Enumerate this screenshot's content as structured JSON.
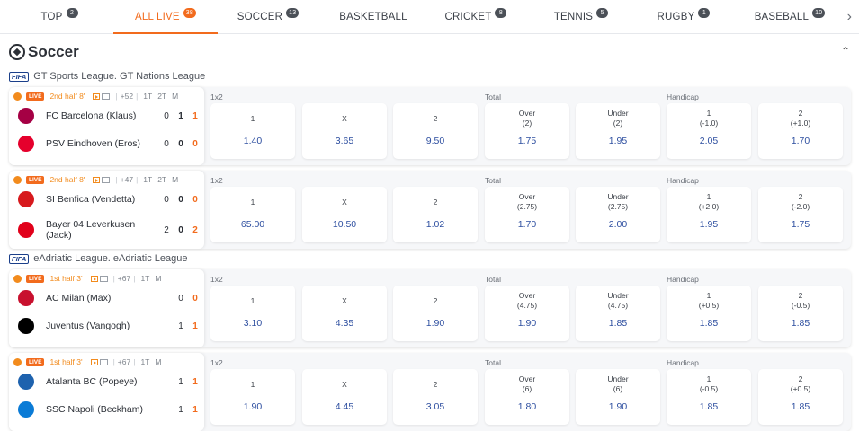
{
  "tabs": [
    {
      "label": "TOP",
      "count": "2"
    },
    {
      "label": "ALL LIVE",
      "count": "38",
      "active": true
    },
    {
      "label": "SOCCER",
      "count": "13"
    },
    {
      "label": "BASKETBALL",
      "count": ""
    },
    {
      "label": "CRICKET",
      "count": "8"
    },
    {
      "label": "TENNIS",
      "count": "5"
    },
    {
      "label": "RUGBY",
      "count": "1"
    },
    {
      "label": "BASEBALL",
      "count": "10"
    }
  ],
  "section": {
    "title": "Soccer"
  },
  "leagues": [
    {
      "badge": "FIFA",
      "name": "GT Sports League. GT Nations League"
    },
    {
      "badge": "FIFA",
      "name": "eAdriatic League. eAdriatic League"
    }
  ],
  "market_labels": {
    "m1x2": "1x2",
    "total": "Total",
    "handicap": "Handicap"
  },
  "score_headers": {
    "h1": "1T",
    "h2": "2T",
    "h3": "M"
  },
  "matches": [
    {
      "live": "LIVE",
      "period": "2nd half 8'",
      "more": "+52",
      "home": {
        "name": "FC Barcelona (Klaus)",
        "s1": "0",
        "s2": "1",
        "s3": "1"
      },
      "away": {
        "name": "PSV Eindhoven (Eros)",
        "s1": "0",
        "s2": "0",
        "s3": "0"
      },
      "odds": [
        {
          "label": "1",
          "value": "1.40"
        },
        {
          "label": "X",
          "value": "3.65"
        },
        {
          "label": "2",
          "value": "9.50"
        },
        {
          "label": "Over",
          "sub": "(2)",
          "value": "1.75"
        },
        {
          "label": "Under",
          "sub": "(2)",
          "value": "1.95"
        },
        {
          "label": "1",
          "sub": "(-1.0)",
          "value": "2.05"
        },
        {
          "label": "2",
          "sub": "(+1.0)",
          "value": "1.70"
        }
      ]
    },
    {
      "live": "LIVE",
      "period": "2nd half 8'",
      "more": "+47",
      "home": {
        "name": "SI Benfica (Vendetta)",
        "s1": "0",
        "s2": "0",
        "s3": "0"
      },
      "away": {
        "name": "Bayer 04 Leverkusen (Jack)",
        "s1": "2",
        "s2": "0",
        "s3": "2"
      },
      "odds": [
        {
          "label": "1",
          "value": "65.00"
        },
        {
          "label": "X",
          "value": "10.50"
        },
        {
          "label": "2",
          "value": "1.02"
        },
        {
          "label": "Over",
          "sub": "(2.75)",
          "value": "1.70"
        },
        {
          "label": "Under",
          "sub": "(2.75)",
          "value": "2.00"
        },
        {
          "label": "1",
          "sub": "(+2.0)",
          "value": "1.95"
        },
        {
          "label": "2",
          "sub": "(-2.0)",
          "value": "1.75"
        }
      ]
    },
    {
      "live": "LIVE",
      "period": "1st half 3'",
      "more": "+67",
      "home": {
        "name": "AC Milan (Max)",
        "s1": "0",
        "s3": "0"
      },
      "away": {
        "name": "Juventus (Vangogh)",
        "s1": "1",
        "s3": "1"
      },
      "odds": [
        {
          "label": "1",
          "value": "3.10"
        },
        {
          "label": "X",
          "value": "4.35"
        },
        {
          "label": "2",
          "value": "1.90"
        },
        {
          "label": "Over",
          "sub": "(4.75)",
          "value": "1.90"
        },
        {
          "label": "Under",
          "sub": "(4.75)",
          "value": "1.85"
        },
        {
          "label": "1",
          "sub": "(+0.5)",
          "value": "1.85"
        },
        {
          "label": "2",
          "sub": "(-0.5)",
          "value": "1.85"
        }
      ]
    },
    {
      "live": "LIVE",
      "period": "1st half 3'",
      "more": "+67",
      "home": {
        "name": "Atalanta BC (Popeye)",
        "s1": "1",
        "s3": "1"
      },
      "away": {
        "name": "SSC Napoli (Beckham)",
        "s1": "1",
        "s3": "1"
      },
      "odds": [
        {
          "label": "1",
          "value": "1.90"
        },
        {
          "label": "X",
          "value": "4.45"
        },
        {
          "label": "2",
          "value": "3.05"
        },
        {
          "label": "Over",
          "sub": "(6)",
          "value": "1.80"
        },
        {
          "label": "Under",
          "sub": "(6)",
          "value": "1.90"
        },
        {
          "label": "1",
          "sub": "(-0.5)",
          "value": "1.85"
        },
        {
          "label": "2",
          "sub": "(+0.5)",
          "value": "1.85"
        }
      ]
    }
  ],
  "colors": {
    "accent": "#f26b1d",
    "odd_value": "#2e4fa0"
  },
  "icons": {
    "next": "chevron-right-icon",
    "collapse": "chevron-up-icon",
    "sport": "soccer-ball-icon"
  }
}
